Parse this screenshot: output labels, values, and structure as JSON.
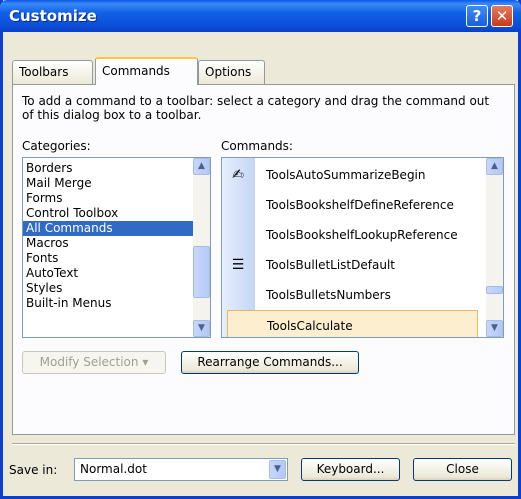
{
  "window": {
    "title": "Customize",
    "help_label": "?",
    "close_label": "✕"
  },
  "tabs": [
    {
      "label": "Toolbars",
      "active": false
    },
    {
      "label": "Commands",
      "active": true
    },
    {
      "label": "Options",
      "active": false
    }
  ],
  "description": "To add a command to a toolbar: select a category and drag the command out of this dialog box to a toolbar.",
  "categories": {
    "label": "Categories:",
    "selected": "All Commands",
    "items": [
      "Borders",
      "Mail Merge",
      "Forms",
      "Control Toolbox",
      "All Commands",
      "Macros",
      "Fonts",
      "AutoText",
      "Styles",
      "Built-in Menus"
    ]
  },
  "commands": {
    "label": "Commands:",
    "selected": "ToolsCalculate",
    "items": [
      {
        "label": "ToolsAutoSummarizeBegin",
        "icon": "autosummarize-icon"
      },
      {
        "label": "ToolsBookshelfDefineReference",
        "icon": ""
      },
      {
        "label": "ToolsBookshelfLookupReference",
        "icon": ""
      },
      {
        "label": "ToolsBulletListDefault",
        "icon": "bullet-list-icon"
      },
      {
        "label": "ToolsBulletsNumbers",
        "icon": ""
      },
      {
        "label": "ToolsCalculate",
        "icon": ""
      }
    ]
  },
  "buttons": {
    "modify_selection": "Modify Selection",
    "rearrange_commands": "Rearrange Commands...",
    "keyboard": "Keyboard...",
    "close": "Close"
  },
  "save_in": {
    "label": "Save in:",
    "value": "Normal.dot"
  },
  "colors": {
    "selection": "#316ac5",
    "titlebar": "#0a58e8",
    "command_highlight": "#fdeecf"
  }
}
